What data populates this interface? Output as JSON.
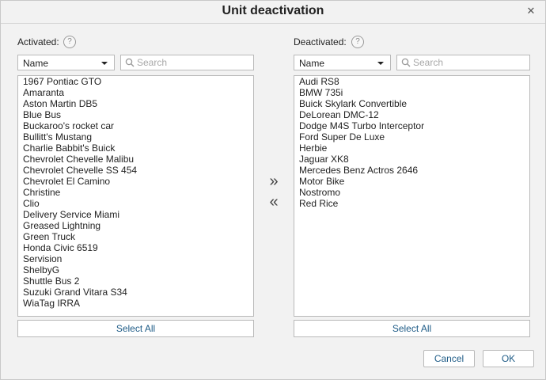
{
  "dialog": {
    "title": "Unit deactivation",
    "close_icon": "close-icon"
  },
  "activated": {
    "label": "Activated:",
    "help_glyph": "?",
    "sort_value": "Name",
    "search_placeholder": "Search",
    "items": [
      "1967 Pontiac GTO",
      "Amaranta",
      "Aston Martin DB5",
      "Blue Bus",
      "Buckaroo's rocket car",
      "Bullitt's Mustang",
      "Charlie Babbit's Buick",
      "Chevrolet Chevelle Malibu",
      "Chevrolet Chevelle SS 454",
      "Chevrolet El Camino",
      "Christine",
      "Clio",
      "Delivery Service Miami",
      "Greased Lightning",
      "Green Truck",
      "Honda Civic 6519",
      "Servision",
      "ShelbyG",
      "Shuttle Bus 2",
      "Suzuki Grand Vitara S34",
      "WiaTag IRRA"
    ],
    "select_all_label": "Select All"
  },
  "deactivated": {
    "label": "Deactivated:",
    "help_glyph": "?",
    "sort_value": "Name",
    "search_placeholder": "Search",
    "items": [
      "Audi RS8",
      "BMW 735i",
      "Buick Skylark Convertible",
      "DeLorean DMC-12",
      "Dodge M4S Turbo Interceptor",
      "Ford Super De Luxe",
      "Herbie",
      "Jaguar XK8",
      "Mercedes Benz Actros 2646",
      "Motor Bike",
      "Nostromo",
      "Red Rice"
    ],
    "select_all_label": "Select All"
  },
  "transfer": {
    "move_right_glyph": "»",
    "move_left_glyph": "«"
  },
  "footer": {
    "cancel_label": "Cancel",
    "ok_label": "OK"
  },
  "colors": {
    "background": "#f2f2f2",
    "link_text": "#1f5c87",
    "border": "#b9b9b9"
  }
}
